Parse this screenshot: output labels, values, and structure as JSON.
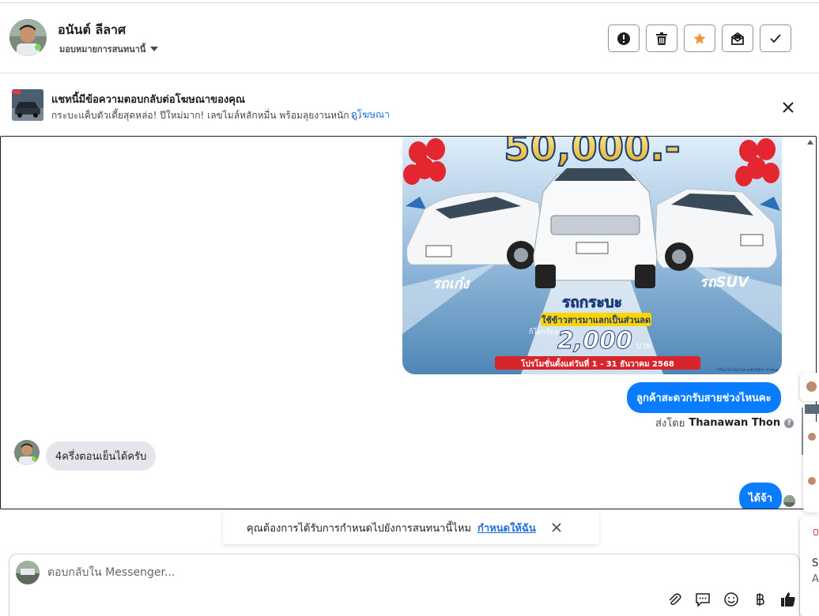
{
  "header": {
    "name": "อนันต์ ลีลาศ",
    "assign_label": "มอบหมายการสนทนานี้",
    "actions": [
      "report-icon",
      "trash-icon",
      "star-icon",
      "mark-unread-icon",
      "check-icon"
    ],
    "colors": {
      "star": "#f7923b",
      "border": "#8d949e"
    }
  },
  "ad_banner": {
    "title": "แชทนี้มีข้อความตอบกลับต่อโฆษณาของคุณ",
    "description": "กระบะแค็บตัวเตี้ยสุดหล่อ! ปีใหม่มาก! เลขไมล์หลักหมื่น พร้อมลุยงานหนัก ...",
    "link": "ดูโฆษณา"
  },
  "messages": {
    "ad_image": {
      "headline": "50,000.-",
      "left_label": "รถเก๋ง",
      "right_label": "รถSUV",
      "center_label": "รถกระบะ",
      "promo_line": "ใช้ข้าวสารมาแลกเป็นส่วนลด",
      "per_km": "กิโลกรัมละ",
      "price": "2,000",
      "price_unit": "บาท",
      "period": "โปรโมชั่นตั้งแต่วันที่ 1 - 31 ธันวาคม 2568",
      "fine_print": "*เงื่อนไขเป็นไปตามที่บริษัทฯ กำหนด"
    },
    "outgoing_1": "ลูกค้าสะดวกรับสายช่วงไหนคะ",
    "sent_by_prefix": "ส่งโดย",
    "sent_by_name": "Thanawan Thon",
    "incoming_1": "4ครึ่งตอนเย็นได้ครับ",
    "outgoing_2": "ได้จ้า",
    "colors": {
      "outgoing": "#0a7cff",
      "incoming": "#e4e6eb"
    }
  },
  "toast": {
    "text": "คุณต้องการได้รับการกำหนดไปยังการสนทนานี้ไหม",
    "link": "กำหนดให้ฉัน"
  },
  "composer": {
    "placeholder": "ตอบกลับใน Messenger...",
    "icons": [
      "attach-icon",
      "saved-reply-icon",
      "emoji-icon",
      "baht-icon",
      "like-icon"
    ]
  },
  "side_panel": {
    "letter_1": "S",
    "letter_2": "A"
  }
}
